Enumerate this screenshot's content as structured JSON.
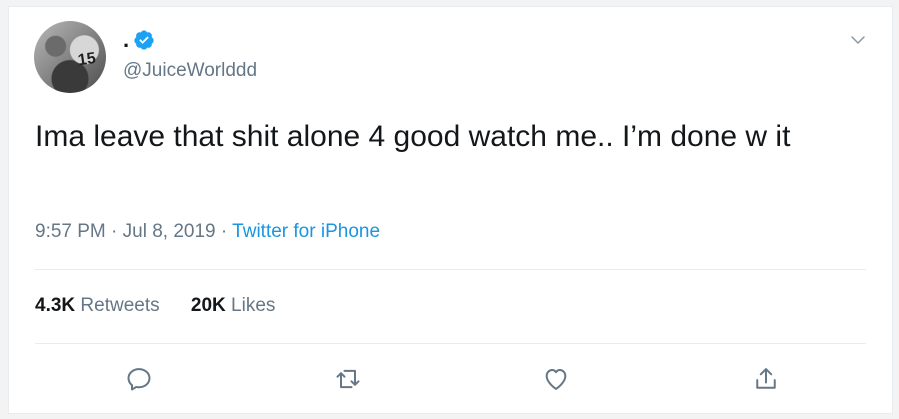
{
  "user": {
    "display_name": ".",
    "handle": "@JuiceWorlddd",
    "verified": true,
    "avatar_text": "15"
  },
  "tweet": {
    "text": "Ima leave that shit alone 4 good watch me.. I’m done w it",
    "time": "9:57 PM",
    "date": "Jul 8, 2019",
    "separator": " · ",
    "source": "Twitter for iPhone"
  },
  "stats": {
    "retweets_count": "4.3K",
    "retweets_label": "Retweets",
    "likes_count": "20K",
    "likes_label": "Likes"
  },
  "colors": {
    "accent": "#1b95e0",
    "verified": "#1da1f2",
    "muted": "#657786",
    "text": "#14171a"
  },
  "icons": [
    "verified-badge-icon",
    "chevron-down-icon",
    "reply-icon",
    "retweet-icon",
    "like-icon",
    "share-icon"
  ]
}
